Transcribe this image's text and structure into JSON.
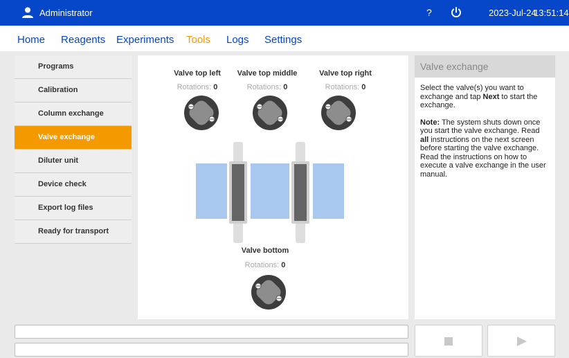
{
  "header": {
    "user": "Administrator",
    "help": "?",
    "date": "2023-Jul-24",
    "time": "13:51:14",
    "icons": {
      "user": "user-icon",
      "power": "power-icon"
    }
  },
  "nav": {
    "items": [
      "Home",
      "Reagents",
      "Experiments",
      "Tools",
      "Logs",
      "Settings"
    ],
    "active": "Tools"
  },
  "sidebar": {
    "items": [
      "Programs",
      "Calibration",
      "Column exchange",
      "Valve exchange",
      "Diluter unit",
      "Device check",
      "Export log files",
      "Ready for transport"
    ],
    "active": "Valve exchange"
  },
  "valves": {
    "top_left": {
      "title": "Valve top left",
      "rotations_label": "Rotations:",
      "rotations": "0"
    },
    "top_middle": {
      "title": "Valve top middle",
      "rotations_label": "Rotations:",
      "rotations": "0"
    },
    "top_right": {
      "title": "Valve top right",
      "rotations_label": "Rotations:",
      "rotations": "0"
    },
    "bottom": {
      "title": "Valve bottom",
      "rotations_label": "Rotations:",
      "rotations": "0"
    }
  },
  "info": {
    "title": "Valve exchange",
    "p1_a": "Select the valve(s) you want to exchange and tap ",
    "p1_b": "Next",
    "p1_c": " to start the exchange.",
    "p2_a": "Note:",
    "p2_b": " The system shuts down once you start the valve exchange. Read ",
    "p2_c": "all",
    "p2_d": " instructions on the next screen before starting the valve exchange. Read the instructions on how to execute a valve exchange in the user manual."
  },
  "controls": {
    "stop_icon": "stop-icon",
    "play_icon": "play-icon"
  },
  "colors": {
    "header": "#0646c9",
    "accent": "#f49a00",
    "link": "#0646c9"
  }
}
